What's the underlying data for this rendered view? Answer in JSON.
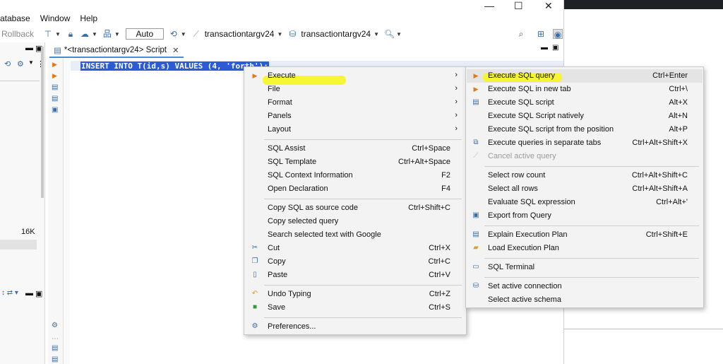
{
  "menubar": {
    "items": [
      "atabase",
      "Window",
      "Help"
    ]
  },
  "window_controls": {
    "minimize": "—",
    "maximize": "☐",
    "close": "✕"
  },
  "toolbar": {
    "rollback_label": "Rollback",
    "mode_value": "Auto",
    "connection_label": "transactiontargv24",
    "database_label": "transactiontargv24"
  },
  "left_panel": {
    "size_label": "16K"
  },
  "editor": {
    "tab_label": "*<transactiontargv24> Script",
    "code": "INSERT INTO T(id,s) VALUES (4, 'forth');"
  },
  "context_menu": {
    "items": [
      {
        "label": "Execute",
        "shortcut": "",
        "submenu": true
      },
      {
        "label": "File",
        "shortcut": "",
        "submenu": true
      },
      {
        "label": "Format",
        "shortcut": "",
        "submenu": true
      },
      {
        "label": "Panels",
        "shortcut": "",
        "submenu": true
      },
      {
        "label": "Layout",
        "shortcut": "",
        "submenu": true
      },
      {
        "label": "SQL Assist",
        "shortcut": "Ctrl+Space"
      },
      {
        "label": "SQL Template",
        "shortcut": "Ctrl+Alt+Space"
      },
      {
        "label": "SQL Context Information",
        "shortcut": "F2"
      },
      {
        "label": "Open Declaration",
        "shortcut": "F4"
      },
      {
        "label": "Copy SQL as source code",
        "shortcut": "Ctrl+Shift+C"
      },
      {
        "label": "Copy selected query",
        "shortcut": ""
      },
      {
        "label": "Search selected text with Google",
        "shortcut": ""
      },
      {
        "label": "Cut",
        "shortcut": "Ctrl+X"
      },
      {
        "label": "Copy",
        "shortcut": "Ctrl+C"
      },
      {
        "label": "Paste",
        "shortcut": "Ctrl+V"
      },
      {
        "label": "Undo Typing",
        "shortcut": "Ctrl+Z"
      },
      {
        "label": "Save",
        "shortcut": "Ctrl+S"
      },
      {
        "label": "Preferences...",
        "shortcut": ""
      }
    ]
  },
  "execute_submenu": {
    "items": [
      {
        "label": "Execute SQL query",
        "shortcut": "Ctrl+Enter"
      },
      {
        "label": "Execute SQL in new tab",
        "shortcut": "Ctrl+\\"
      },
      {
        "label": "Execute SQL script",
        "shortcut": "Alt+X"
      },
      {
        "label": "Execute SQL Script natively",
        "shortcut": "Alt+N"
      },
      {
        "label": "Execute SQL script from the position",
        "shortcut": "Alt+P"
      },
      {
        "label": "Execute queries in separate tabs",
        "shortcut": "Ctrl+Alt+Shift+X"
      },
      {
        "label": "Cancel active query",
        "shortcut": ""
      },
      {
        "label": "Select row count",
        "shortcut": "Ctrl+Alt+Shift+C"
      },
      {
        "label": "Select all rows",
        "shortcut": "Ctrl+Alt+Shift+A"
      },
      {
        "label": "Evaluate SQL expression",
        "shortcut": "Ctrl+Alt+'"
      },
      {
        "label": "Export from Query",
        "shortcut": ""
      },
      {
        "label": "Explain Execution Plan",
        "shortcut": "Ctrl+Shift+E"
      },
      {
        "label": "Load Execution Plan",
        "shortcut": ""
      },
      {
        "label": "SQL Terminal",
        "shortcut": ""
      },
      {
        "label": "Set active connection",
        "shortcut": ""
      },
      {
        "label": "Select active schema",
        "shortcut": ""
      }
    ]
  },
  "colors": {
    "highlight": "#f5f52a",
    "selection": "#2b5bd6",
    "accent": "#4a8bd6"
  }
}
